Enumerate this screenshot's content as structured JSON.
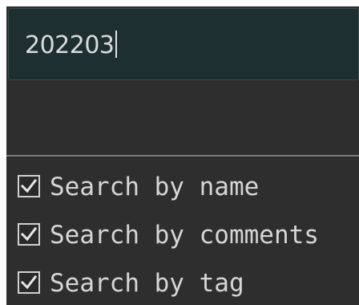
{
  "search": {
    "value": "202203"
  },
  "options": [
    {
      "label": "Search by name",
      "checked": true
    },
    {
      "label": "Search by comments",
      "checked": true
    },
    {
      "label": "Search by tag",
      "checked": true
    }
  ],
  "colors": {
    "panel_bg": "#2e2e2e",
    "search_bg": "#1e2f32",
    "text": "#d6d6d6"
  }
}
